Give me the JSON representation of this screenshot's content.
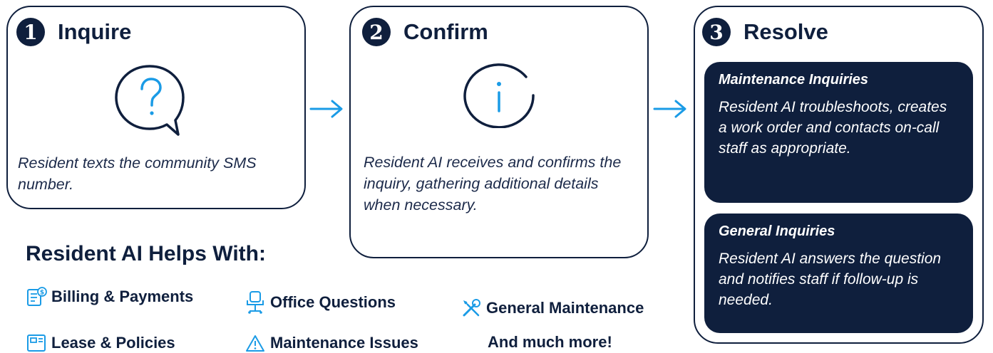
{
  "steps": [
    {
      "number": "1",
      "title": "Inquire",
      "icon": "question-bubble-icon",
      "description": "Resident texts the community SMS number."
    },
    {
      "number": "2",
      "title": "Confirm",
      "icon": "info-circle-icon",
      "description": "Resident AI receives and confirms the inquiry, gathering additional details when necessary."
    },
    {
      "number": "3",
      "title": "Resolve"
    }
  ],
  "resolve_panels": [
    {
      "title": "Maintenance Inquiries",
      "text": "Resident AI troubleshoots, creates a work order and contacts on-call staff as appropriate."
    },
    {
      "title": "General Inquiries",
      "text": "Resident AI answers the question and notifies staff if follow-up is needed."
    }
  ],
  "helps": {
    "title": "Resident AI Helps With:",
    "items": [
      {
        "label": "Billing & Payments",
        "icon": "billing-icon"
      },
      {
        "label": "Office Questions",
        "icon": "office-chair-icon"
      },
      {
        "label": "General Maintenance",
        "icon": "tools-icon"
      },
      {
        "label": "Lease & Policies",
        "icon": "lease-document-icon"
      },
      {
        "label": "Maintenance Issues",
        "icon": "warning-icon"
      },
      {
        "label": "And much more!"
      }
    ]
  },
  "colors": {
    "navy": "#0f1f3d",
    "accent": "#1a9be6"
  }
}
